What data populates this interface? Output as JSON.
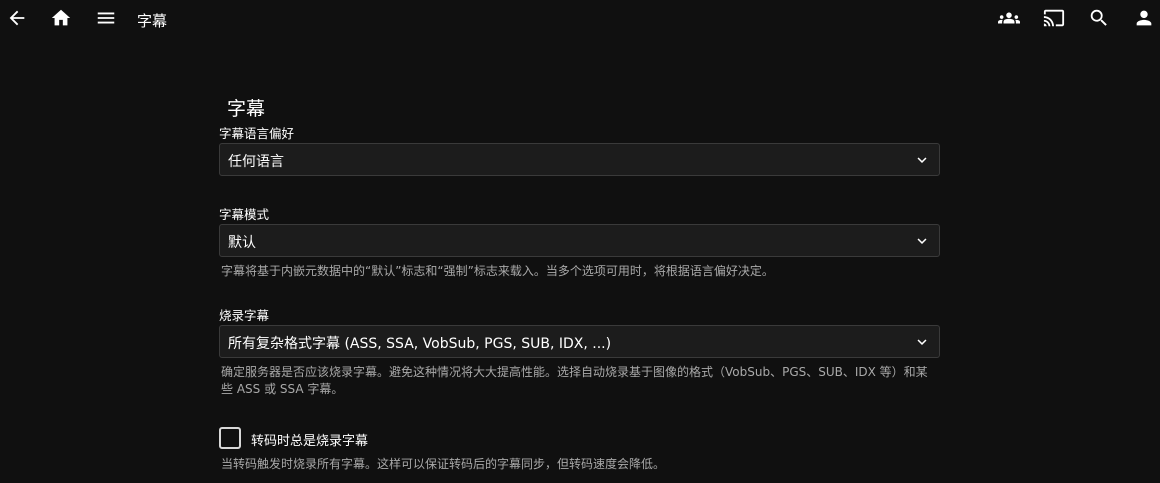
{
  "header": {
    "title": "字幕",
    "icons": [
      "back-arrow-icon",
      "home-icon",
      "menu-icon",
      "people-icon",
      "cast-icon",
      "search-icon",
      "user-icon"
    ]
  },
  "section": {
    "title": "字幕"
  },
  "language_pref": {
    "label": "字幕语言偏好",
    "value": "任何语言"
  },
  "subtitle_mode": {
    "label": "字幕模式",
    "value": "默认",
    "help": "字幕将基于内嵌元数据中的“默认”标志和“强制”标志来载入。当多个选项可用时，将根据语言偏好决定。"
  },
  "burn_subtitles": {
    "label": "烧录字幕",
    "value": "所有复杂格式字幕 (ASS, SSA, VobSub, PGS, SUB, IDX, ...)",
    "help": "确定服务器是否应该烧录字幕。避免这种情况将大大提高性能。选择自动烧录基于图像的格式（VobSub、PGS、SUB、IDX 等）和某些 ASS 或 SSA 字幕。"
  },
  "always_burn": {
    "label": "转码时总是烧录字幕",
    "checked": false,
    "help": "当转码触发时烧录所有字幕。这样可以保证转码后的字幕同步，但转码速度会降低。"
  }
}
